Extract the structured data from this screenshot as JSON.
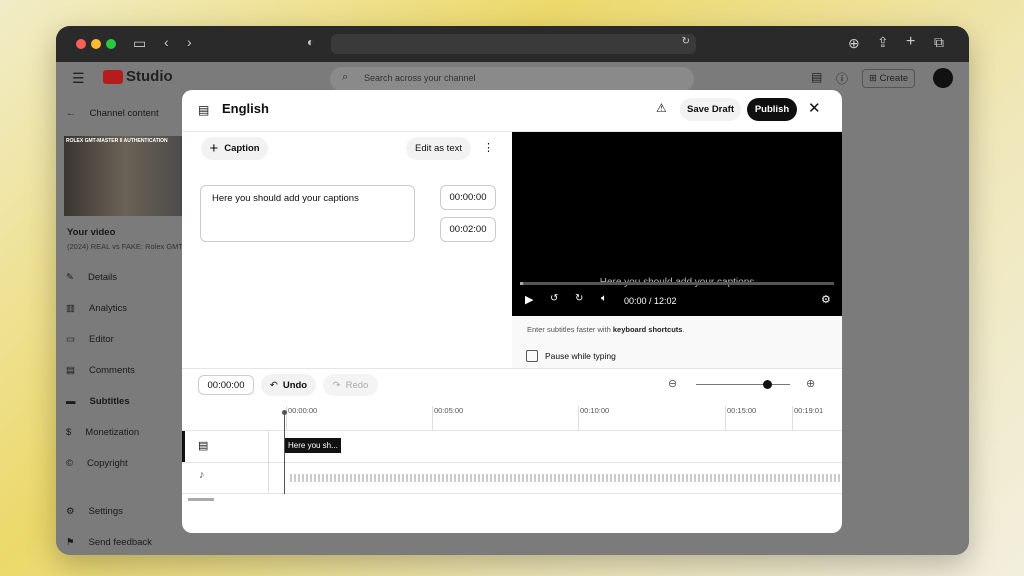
{
  "browser": {
    "icons": [
      "sidebar-icon",
      "back-icon",
      "forward-icon",
      "shield-icon",
      "reload-icon",
      "download-icon",
      "share-icon",
      "new-tab-icon",
      "tabs-icon"
    ]
  },
  "studio": {
    "logo": "Studio",
    "search_placeholder": "Search across your channel",
    "create": "Create"
  },
  "sidebar": {
    "back_label": "Channel content",
    "thumbnail_text": "ROLEX GMT-MASTER II AUTHENTICATION",
    "video_heading": "Your video",
    "video_title": "(2024) REAL vs FAKE: Rolex GMT-",
    "items": [
      {
        "label": "Details",
        "icon": "pencil-icon"
      },
      {
        "label": "Analytics",
        "icon": "analytics-icon"
      },
      {
        "label": "Editor",
        "icon": "editor-icon"
      },
      {
        "label": "Comments",
        "icon": "comments-icon"
      },
      {
        "label": "Subtitles",
        "icon": "subtitles-icon",
        "active": true
      },
      {
        "label": "Monetization",
        "icon": "dollar-icon"
      },
      {
        "label": "Copyright",
        "icon": "copyright-icon"
      }
    ],
    "settings": "Settings",
    "feedback": "Send feedback"
  },
  "modal": {
    "title": "English",
    "save_draft": "Save Draft",
    "publish": "Publish",
    "add_caption": "Caption",
    "edit_as_text": "Edit as text",
    "caption_text": "Here you should add your captions",
    "start_time": "00:00:00",
    "end_time": "00:02:00",
    "player": {
      "overlay_caption": "Here you should add your captions",
      "time": "00:00 / 12:02",
      "progress": 0.01
    },
    "hint_prefix": "Enter subtitles faster with ",
    "hint_link": "keyboard shortcuts",
    "hint_suffix": ".",
    "pause_label": "Pause while typing",
    "pause_checked": false,
    "timeline": {
      "current": "00:00:00",
      "undo": "Undo",
      "redo": "Redo",
      "zoom_level": 0.75,
      "ticks": [
        "00:00:00",
        "00:05:00",
        "00:10:00",
        "00:15:00",
        "00:19:01"
      ],
      "caption_chip": "Here you sh..."
    }
  }
}
